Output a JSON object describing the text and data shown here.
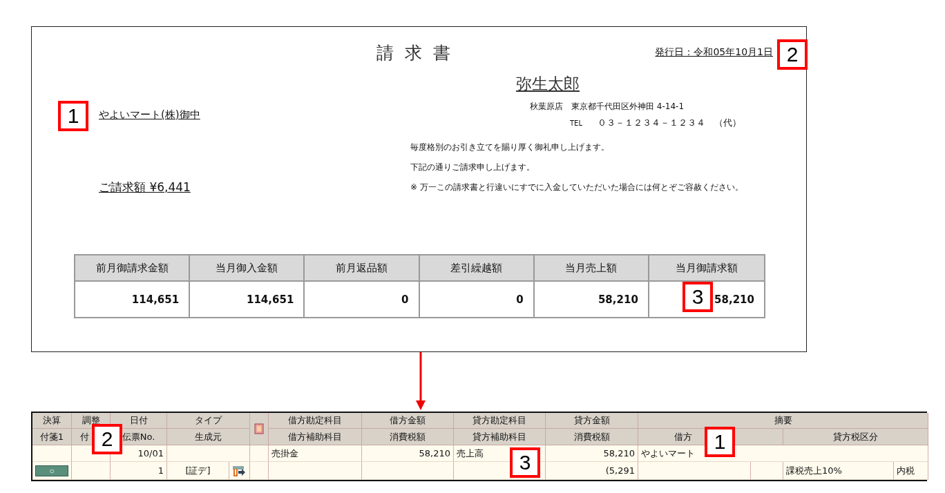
{
  "invoice": {
    "title": "請 求 書",
    "issue_date": "発行日：令和05年10月1日",
    "customer": "やよいマート(株)御中",
    "claim_amount": "ご請求額 ¥6,441",
    "issuer": {
      "name": "弥生太郎",
      "address": "秋葉原店　東京都千代田区外神田 4-14-1",
      "tel_label": "TEL",
      "tel": "０３－１２３４－１２３４　（代）"
    },
    "messages": [
      "毎度格別のお引き立てを賜り厚く御礼申し上げます。",
      "下記の通りご請求申し上げます。",
      "※ 万一この請求書と行違いにすでに入金していただいた場合には何とぞご容赦ください。"
    ],
    "summary_table": {
      "columns": [
        "前月御請求金額",
        "当月御入金額",
        "前月返品額",
        "差引繰越額",
        "当月売上額",
        "当月御請求額"
      ],
      "values": [
        "114,651",
        "114,651",
        "0",
        "0",
        "58,210",
        "58,210"
      ]
    }
  },
  "journal": {
    "header_top": [
      "決算",
      "調整",
      "日付",
      "タイプ",
      "借方勘定科目",
      "借方金額",
      "貸方勘定科目",
      "貸方金額",
      "摘要"
    ],
    "header_bottom": [
      "付箋1",
      "付",
      "伝票No.",
      "生成元",
      "借方補助科目",
      "消費税額",
      "貸方補助科目",
      "消費税額",
      "借方",
      "貸方税区分"
    ],
    "row1": {
      "date": "10/01",
      "debit_account": "売掛金",
      "debit_amount": "58,210",
      "credit_account": "売上高",
      "credit_amount": "58,210",
      "summary": "やよいマート"
    },
    "row2": {
      "sticky_button": "○",
      "slip_no": "1",
      "source": "[証デ]",
      "credit_tax": "(5,291",
      "credit_tax_category": "課税売上10%",
      "tax_mode": "内税"
    }
  },
  "annotations": {
    "invoice_customer": "1",
    "invoice_date": "2",
    "invoice_total": "3",
    "journal_adjust": "2",
    "journal_summary": "1",
    "journal_credit": "3"
  }
}
